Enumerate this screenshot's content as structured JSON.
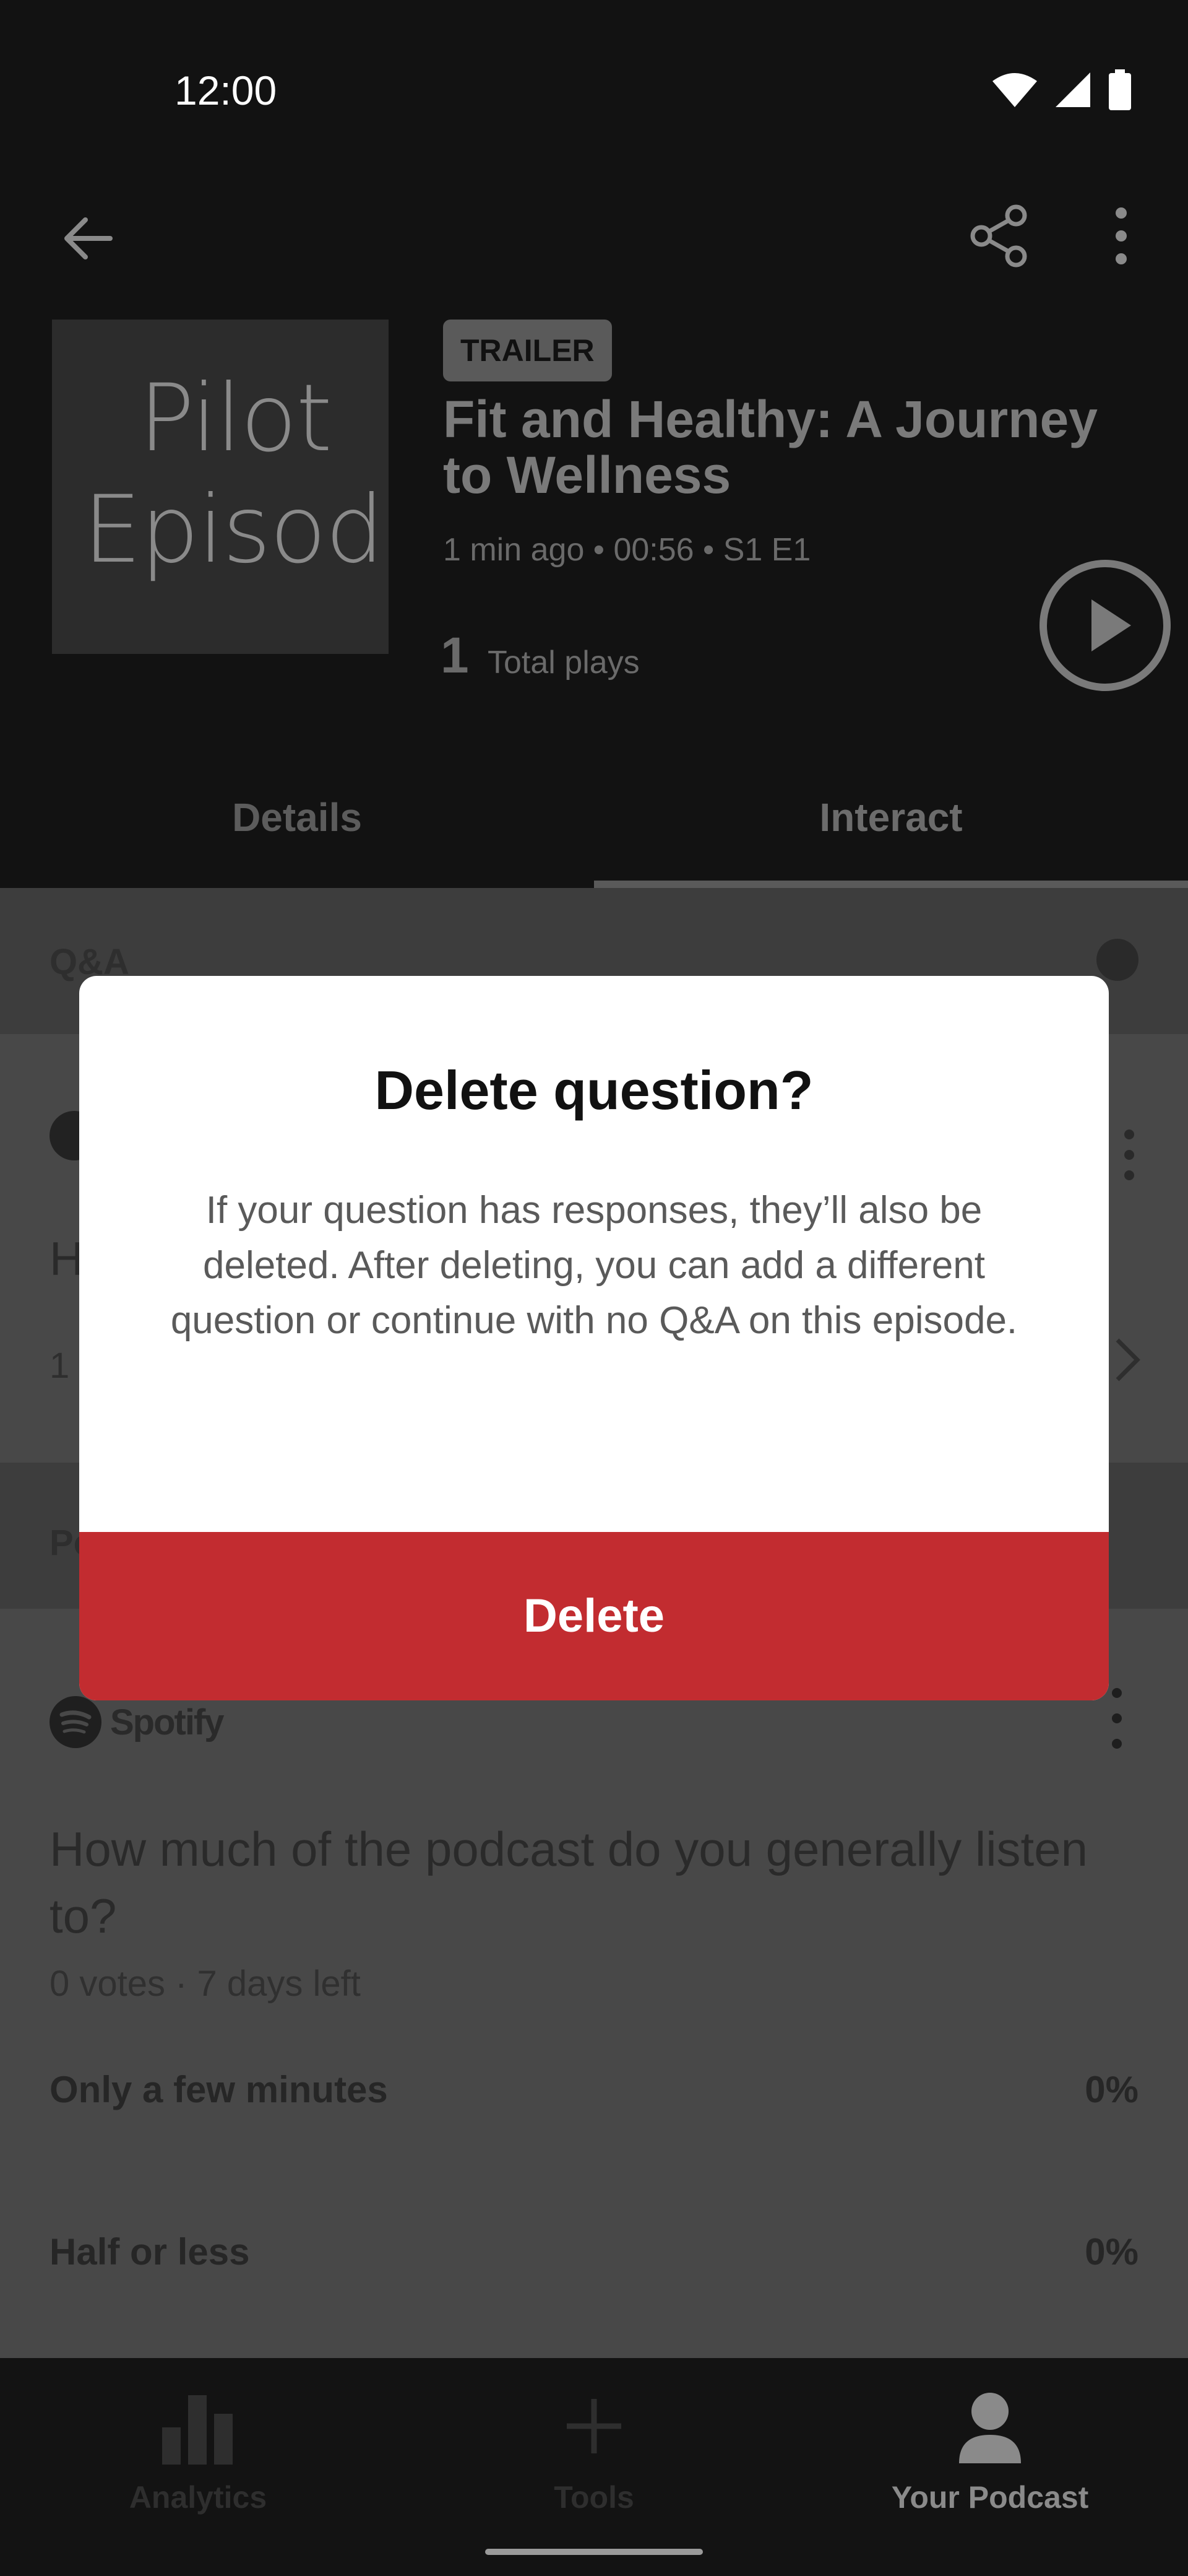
{
  "status_bar": {
    "time": "12:00"
  },
  "episode": {
    "cover_text_line1": "Pilot",
    "cover_text_line2": "Episode",
    "badge": "TRAILER",
    "title": "Fit and Healthy: A Journey to Wellness",
    "meta": "1 min ago • 00:56 • S1 E1",
    "plays_count": "1",
    "plays_label": "Total plays"
  },
  "tabs": [
    {
      "label": "Details"
    },
    {
      "label": "Interact"
    }
  ],
  "qa": {
    "section_title": "Q&A",
    "question_partial": "H",
    "meta_partial": "1 r"
  },
  "poll": {
    "section_title_partial": "Po",
    "brand": "Spotify",
    "question": "How much of the podcast do you generally listen to?",
    "meta": "0 votes  ·  7 days left",
    "options": [
      {
        "label": "Only a few minutes",
        "percent": "0%"
      },
      {
        "label": "Half or less",
        "percent": "0%"
      }
    ]
  },
  "bottom_nav": [
    {
      "label": "Analytics",
      "icon": "bar-chart-icon"
    },
    {
      "label": "Tools",
      "icon": "plus-icon"
    },
    {
      "label": "Your Podcast",
      "icon": "person-icon"
    }
  ],
  "dialog": {
    "title": "Delete question?",
    "body": "If your question has responses, they’ll also be deleted. After deleting, you can add a different question or continue with no Q&A on this episode.",
    "delete_label": "Delete"
  }
}
